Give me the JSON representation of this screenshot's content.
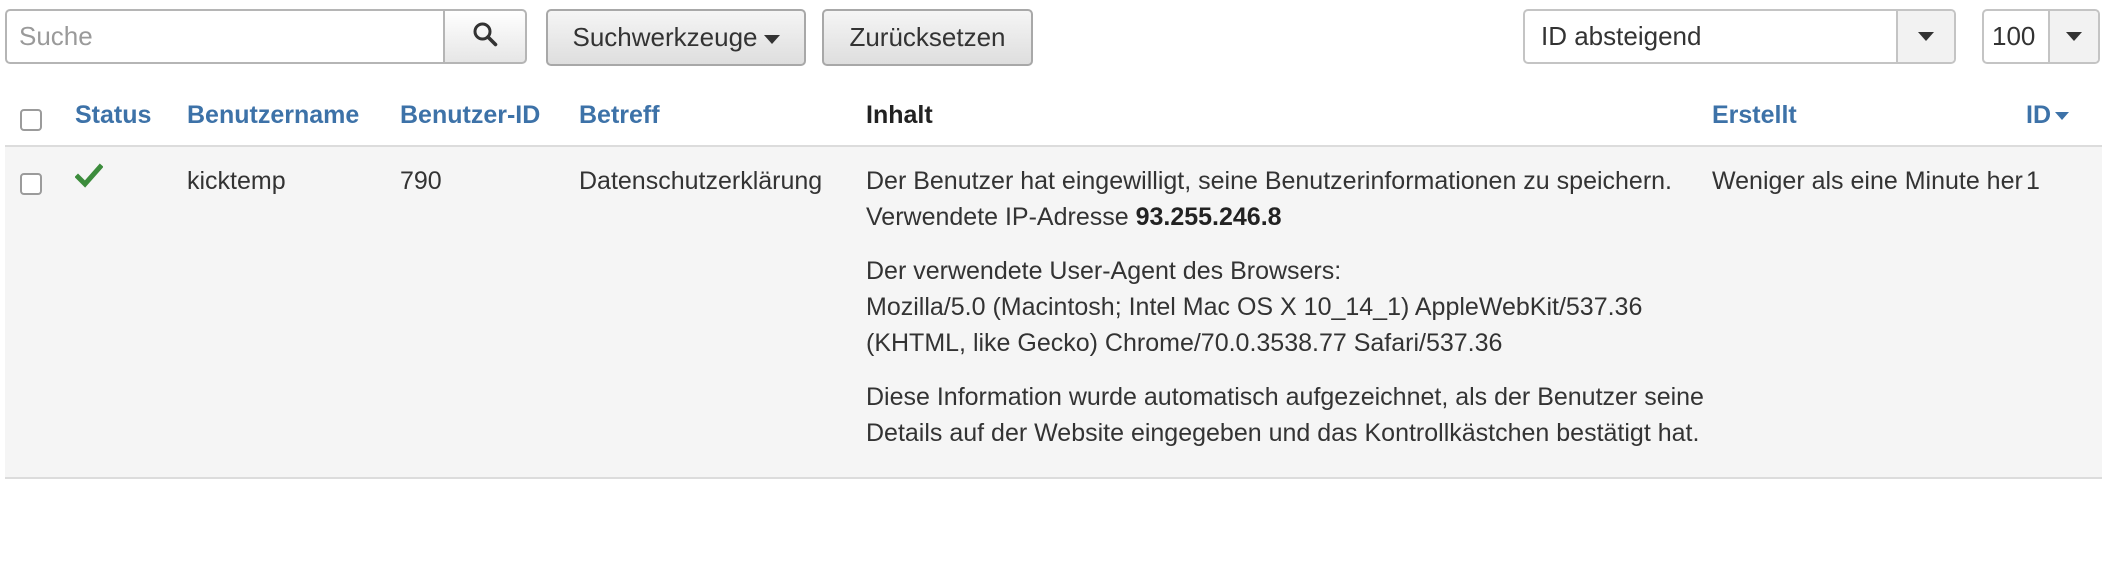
{
  "search": {
    "placeholder": "Suche",
    "value": ""
  },
  "toolbar": {
    "search_tools_label": "Suchwerkzeuge",
    "reset_label": "Zurücksetzen",
    "order_select_value": "ID absteigend",
    "limit_select_value": "100"
  },
  "table": {
    "headers": {
      "status": "Status",
      "username": "Benutzername",
      "user_id": "Benutzer-ID",
      "subject": "Betreff",
      "content": "Inhalt",
      "created": "Erstellt",
      "id": "ID"
    },
    "rows": [
      {
        "status_icon": "check-icon",
        "username": "kicktemp",
        "user_id": "790",
        "subject": "Datenschutzerklärung",
        "content_p1_text": "Der Benutzer hat eingewilligt, seine Benutzerinformationen zu speichern. Verwendete IP-Adresse ",
        "content_p1_ip": "93.255.246.8",
        "content_p2_line1": "Der verwendete User-Agent des Browsers:",
        "content_p2_line2": "Mozilla/5.0 (Macintosh; Intel Mac OS X 10_14_1) AppleWebKit/537.36 (KHTML, like Gecko) Chrome/70.0.3538.77 Safari/537.36",
        "content_p3": "Diese Information wurde automatisch aufgezeichnet, als der Benutzer seine Details auf der Website eingegeben und das Kontrollkästchen bestätigt hat.",
        "created": "Weniger als eine Minute her",
        "id": "1"
      }
    ]
  },
  "colors": {
    "link": "#3d72a8",
    "status_ok": "#3c8c3c",
    "row_bg": "#f5f5f5"
  }
}
